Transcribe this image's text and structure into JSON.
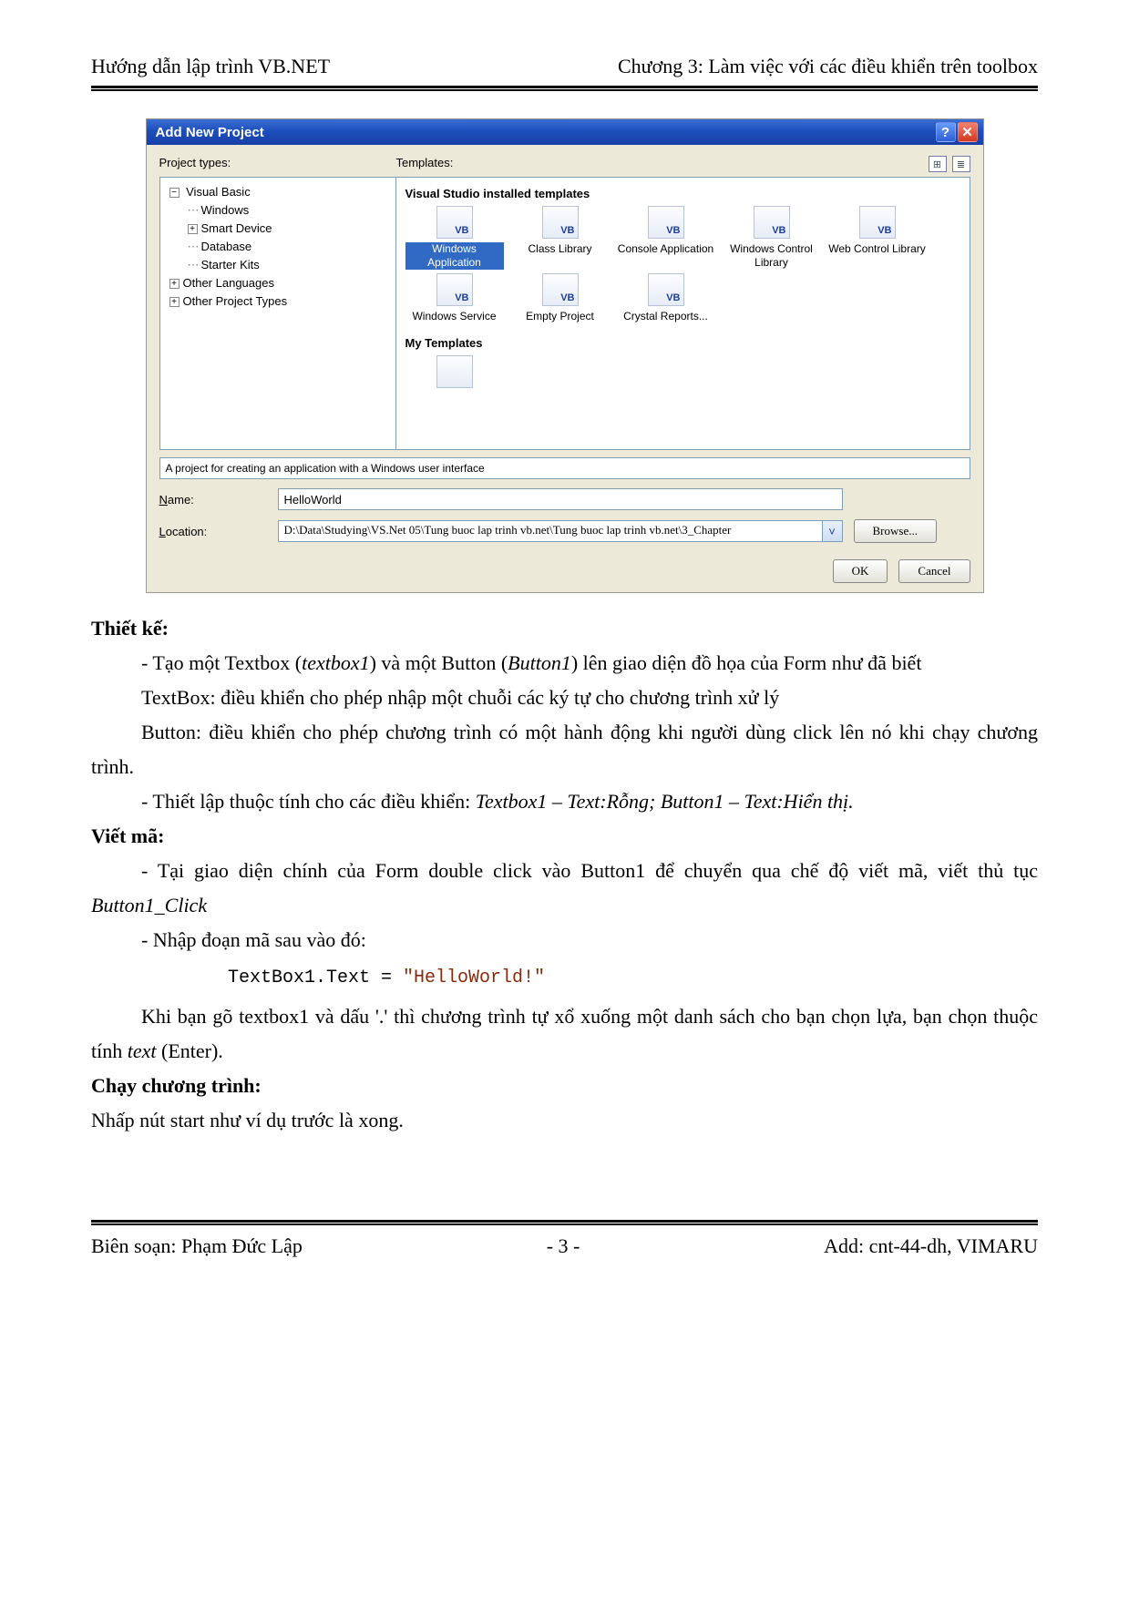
{
  "header": {
    "left": "Hướng dẫn lập trình VB.NET",
    "right": "Chương 3: Làm việc với các điều khiển trên toolbox"
  },
  "dialog": {
    "title": "Add New Project",
    "labels": {
      "project_types": "Project types:",
      "templates": "Templates:",
      "name_label": "Name:",
      "location_label": "Location:"
    },
    "tree": {
      "root": "Visual Basic",
      "items": [
        "Windows",
        "Smart Device",
        "Database",
        "Starter Kits"
      ],
      "siblings": [
        "Other Languages",
        "Other Project Types"
      ],
      "expand_plus": "+",
      "expand_minus": "−"
    },
    "template_groups": {
      "installed": "Visual Studio installed templates",
      "my": "My Templates"
    },
    "templates": [
      {
        "label": "Windows Application",
        "selected": true
      },
      {
        "label": "Class Library"
      },
      {
        "label": "Console Application"
      },
      {
        "label": "Windows Control Library"
      },
      {
        "label": "Web Control Library"
      },
      {
        "label": "Windows Service"
      },
      {
        "label": "Empty Project"
      },
      {
        "label": "Crystal Reports..."
      }
    ],
    "vb_badge": "VB",
    "description": "A project for creating an application with a Windows user interface",
    "name_value": "HelloWorld",
    "location_value": "D:\\Data\\Studying\\VS.Net 05\\Tung buoc lap trinh vb.net\\Tung buoc lap trinh vb.net\\3_Chapter",
    "buttons": {
      "browse": "Browse...",
      "ok": "OK",
      "cancel": "Cancel"
    },
    "view_icons": {
      "large": "⊞",
      "small": "≣"
    },
    "titlebar_icons": {
      "help": "?",
      "close": "✕"
    },
    "arrow_down": "˅"
  },
  "body": {
    "h_design": "Thiết kế:",
    "p1_a": "- Tạo một Textbox (",
    "p1_b": "textbox1",
    "p1_c": ") và một Button (",
    "p1_d": "Button1",
    "p1_e": ") lên giao diện đồ họa của Form như đã biết",
    "p2": "TextBox: điều khiển cho phép nhập một chuỗi các ký tự cho chương trình xử lý",
    "p3": "Button: điều khiển cho phép chương trình có một hành động khi người dùng click lên nó khi chạy chương trình.",
    "p4_a": "- Thiết lập thuộc tính cho các điều khiển: ",
    "p4_b": "Textbox1 – Text:Rỗng; Button1 – Text:Hiển thị.",
    "h_code": "Viết mã:",
    "p5_a": "- Tại giao diện chính của Form double click vào Button1 để chuyển qua chế độ viết mã, viết thủ tục ",
    "p5_b": "Button1_Click",
    "p6": "- Nhập đoạn mã sau vào đó:",
    "code_a": "TextBox1.Text = ",
    "code_b": "\"HelloWorld!\"",
    "p7_a": "Khi bạn gõ textbox1 và dấu '.' thì chương trình tự xổ xuống một danh sách cho bạn chọn lựa, bạn chọn thuộc tính ",
    "p7_b": "text",
    "p7_c": " (Enter).",
    "h_run": "Chạy chương trình:",
    "p8": "Nhấp nút start như ví dụ trước là xong."
  },
  "footer": {
    "left": "Biên soạn: Phạm Đức Lập",
    "center": "- 3 -",
    "right": "Add: cnt-44-dh, VIMARU"
  }
}
